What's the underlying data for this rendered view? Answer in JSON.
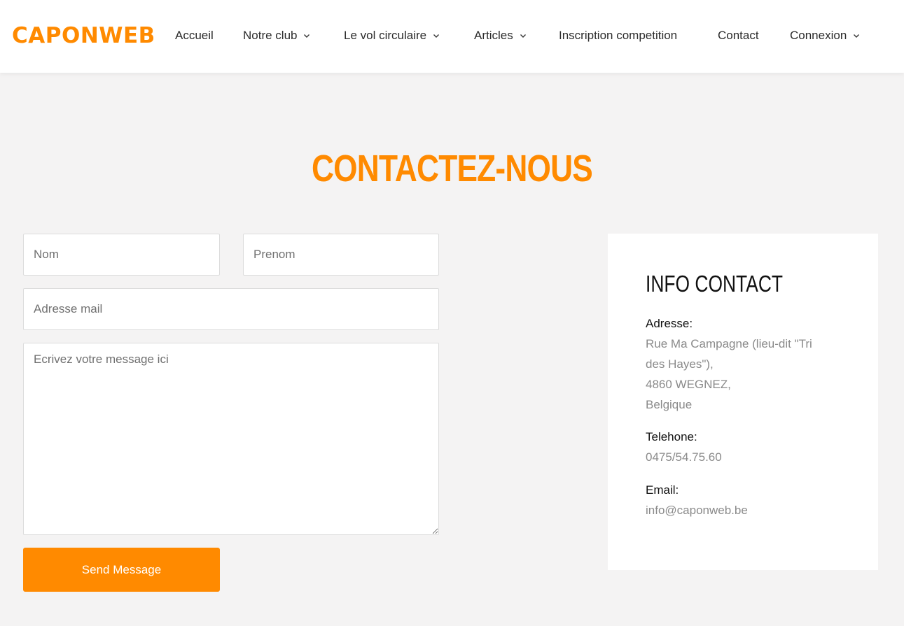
{
  "header": {
    "logo": "CAPONWEB",
    "nav": [
      {
        "label": "Accueil",
        "dropdown": false
      },
      {
        "label": "Notre club",
        "dropdown": true
      },
      {
        "label": "Le vol circulaire",
        "dropdown": true
      },
      {
        "label": "Articles",
        "dropdown": true
      },
      {
        "label": "Inscription competition",
        "dropdown": false
      },
      {
        "label": "Contact",
        "dropdown": false
      },
      {
        "label": "Connexion",
        "dropdown": true
      }
    ]
  },
  "page": {
    "title": "CONTACTEZ-NOUS"
  },
  "form": {
    "nom_placeholder": "Nom",
    "nom_value": "",
    "prenom_placeholder": "Prenom",
    "prenom_value": "",
    "email_placeholder": "Adresse mail",
    "email_value": "",
    "message_placeholder": "Ecrivez votre message ici",
    "message_value": "",
    "submit_label": "Send Message"
  },
  "info": {
    "title": "INFO CONTACT",
    "address_label": "Adresse:",
    "address_lines": [
      "Rue Ma Campagne (lieu-dit \"Tri",
      "des Hayes\"),",
      "4860 WEGNEZ,",
      "Belgique"
    ],
    "phone_label": "Telehone:",
    "phone_value": "0475/54.75.60",
    "email_label": "Email:",
    "email_value": "info@caponweb.be"
  },
  "colors": {
    "accent": "#ff8a00",
    "background": "#f4f3f3",
    "card": "#ffffff"
  }
}
